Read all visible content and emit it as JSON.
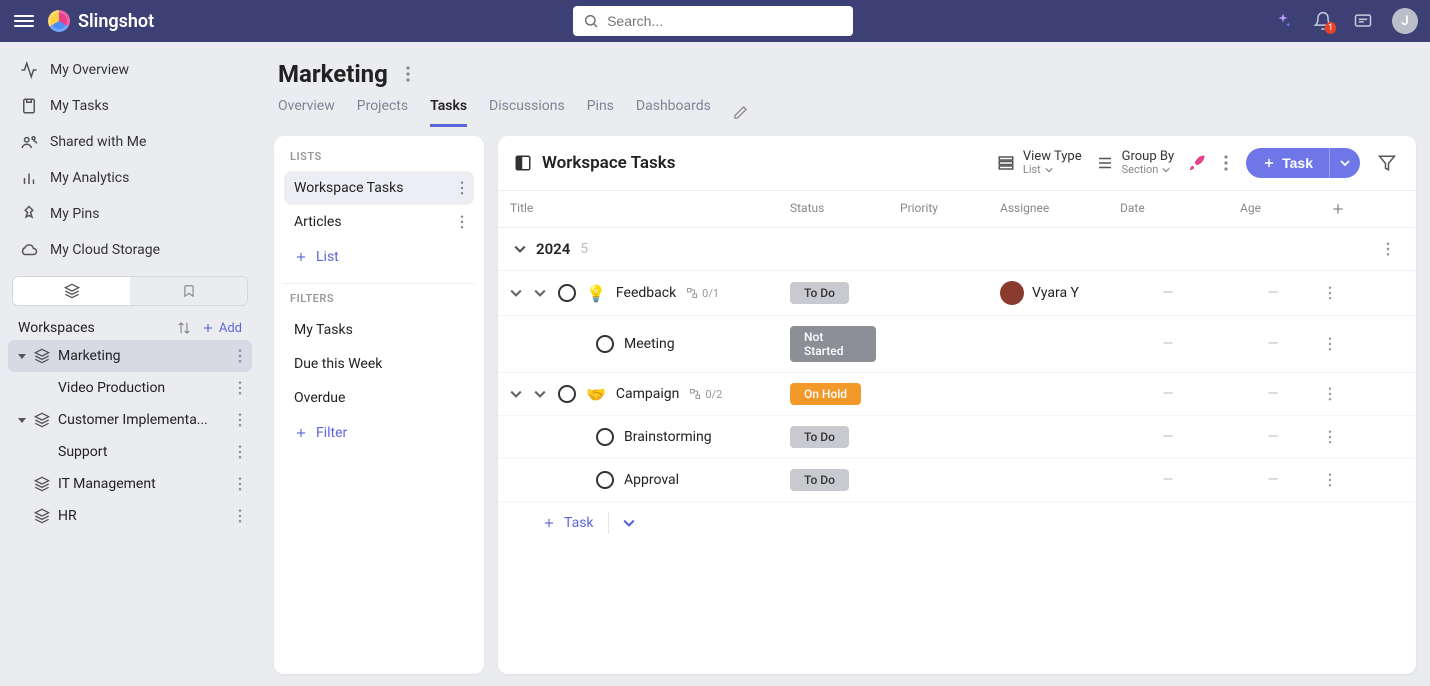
{
  "app_name": "Slingshot",
  "search": {
    "placeholder": "Search..."
  },
  "topbar": {
    "notification_badge": "1",
    "avatar_initial": "J"
  },
  "sidebar": {
    "nav": [
      {
        "label": "My Overview",
        "icon": "activity"
      },
      {
        "label": "My Tasks",
        "icon": "clipboard"
      },
      {
        "label": "Shared with Me",
        "icon": "share"
      },
      {
        "label": "My Analytics",
        "icon": "chart"
      },
      {
        "label": "My Pins",
        "icon": "pin"
      },
      {
        "label": "My Cloud Storage",
        "icon": "cloud"
      }
    ],
    "workspaces_label": "Workspaces",
    "add_label": "Add",
    "items": [
      {
        "label": "Marketing",
        "active": true,
        "children": [
          {
            "label": "Video Production"
          }
        ]
      },
      {
        "label": "Customer Implementa...",
        "children": [
          {
            "label": "Support"
          }
        ]
      },
      {
        "label": "IT Management"
      },
      {
        "label": "HR"
      }
    ]
  },
  "page": {
    "title": "Marketing"
  },
  "tabs": [
    "Overview",
    "Projects",
    "Tasks",
    "Discussions",
    "Pins",
    "Dashboards"
  ],
  "active_tab": "Tasks",
  "lists_panel": {
    "label": "LISTS",
    "items": [
      {
        "label": "Workspace Tasks",
        "active": true
      },
      {
        "label": "Articles"
      }
    ],
    "add_list": "List",
    "filters_label": "FILTERS",
    "filters": [
      "My Tasks",
      "Due this Week",
      "Overdue"
    ],
    "add_filter": "Filter"
  },
  "tasks_panel": {
    "title": "Workspace Tasks",
    "view_type": {
      "label": "View Type",
      "value": "List"
    },
    "group_by": {
      "label": "Group By",
      "value": "Section"
    },
    "task_button": "Task",
    "columns": [
      "Title",
      "Status",
      "Priority",
      "Assignee",
      "Date",
      "Age"
    ],
    "group": {
      "name": "2024",
      "count": "5"
    },
    "rows": [
      {
        "expandable": true,
        "indent": 0,
        "emoji": "💡",
        "title": "Feedback",
        "subtasks": "0/1",
        "status": "To Do",
        "status_class": "pill-todo",
        "assignee": "Vyara Y",
        "has_assignee": true
      },
      {
        "expandable": false,
        "indent": 1,
        "title": "Meeting",
        "status": "Not Started",
        "status_class": "pill-notstarted"
      },
      {
        "expandable": true,
        "indent": 0,
        "emoji": "🤝",
        "title": "Campaign",
        "subtasks": "0/2",
        "status": "On Hold",
        "status_class": "pill-onhold"
      },
      {
        "expandable": false,
        "indent": 1,
        "title": "Brainstorming",
        "status": "To Do",
        "status_class": "pill-todo"
      },
      {
        "expandable": false,
        "indent": 1,
        "title": "Approval",
        "status": "To Do",
        "status_class": "pill-todo"
      }
    ],
    "add_task": "Task"
  }
}
